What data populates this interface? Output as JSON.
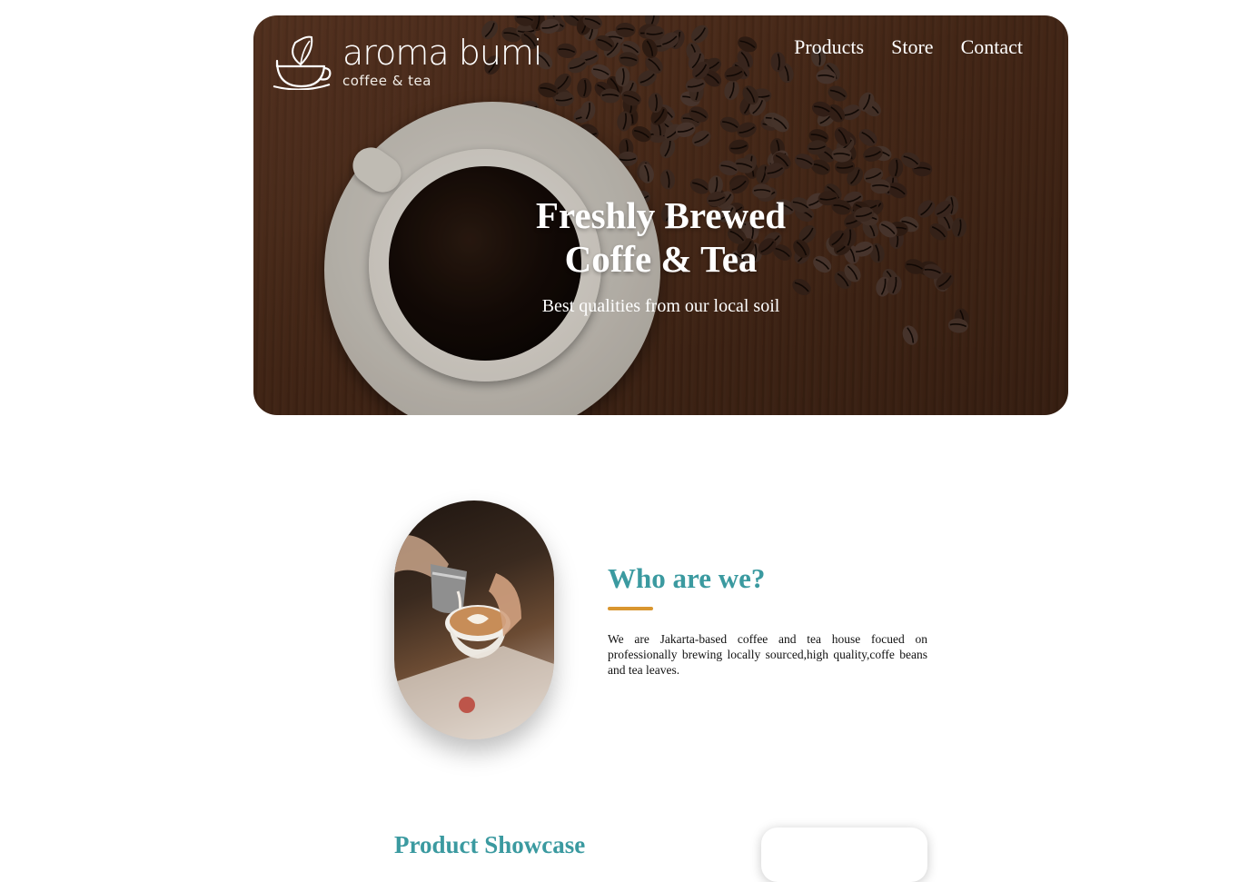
{
  "brand": {
    "name": "aroma bumi",
    "tagline": "coffee & tea"
  },
  "nav": {
    "items": [
      "Products",
      "Store",
      "Contact"
    ]
  },
  "hero": {
    "title_line1": "Freshly Brewed",
    "title_line2": "Coffe & Tea",
    "subtitle": "Best qualities from our local soil"
  },
  "about": {
    "title": "Who are we?",
    "text": "We are Jakarta-based coffee and tea house focued on professionally brewing locally sourced,high quality,coffe beans and tea leaves."
  },
  "showcase": {
    "title": "Product Showcase"
  },
  "colors": {
    "accent_teal": "#3b9aa0",
    "accent_gold": "#d9962f",
    "hero_brown": "#4a2a18"
  },
  "icons": {
    "brand_logo": "cup-leaf-icon"
  }
}
